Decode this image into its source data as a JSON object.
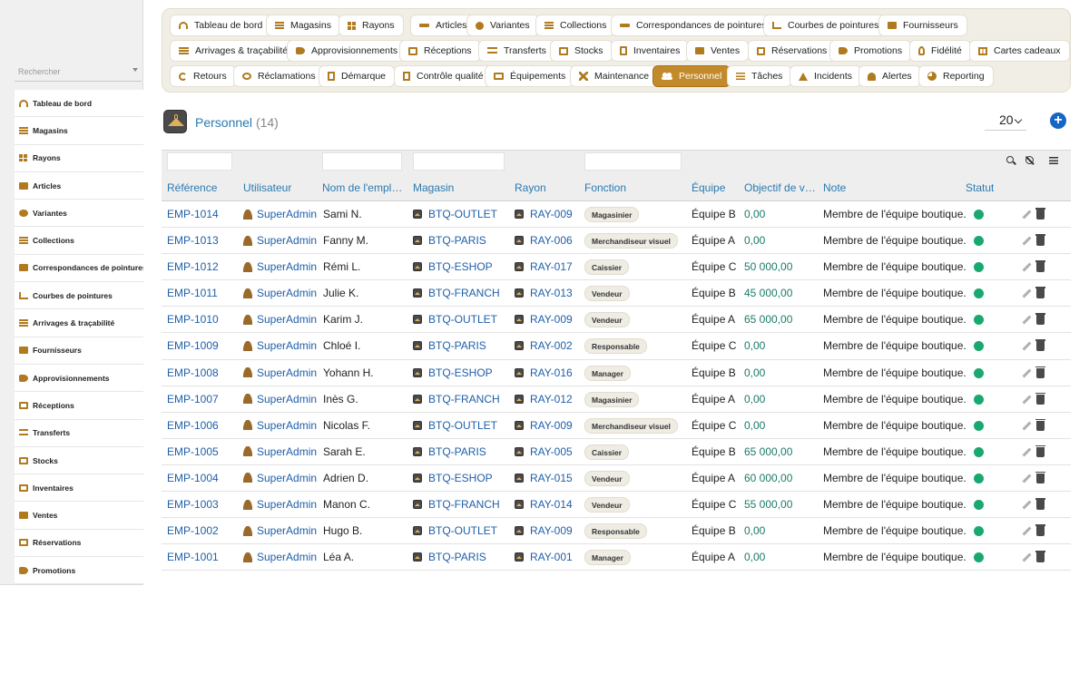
{
  "sidebar": {
    "search_placeholder": "Rechercher",
    "items": [
      {
        "label": "Tableau de bord",
        "icon": "gauge-icon"
      },
      {
        "label": "Magasins",
        "icon": "store-icon"
      },
      {
        "label": "Rayons",
        "icon": "grid-icon"
      },
      {
        "label": "Articles",
        "icon": "shirt-icon"
      },
      {
        "label": "Variantes",
        "icon": "palette-icon"
      },
      {
        "label": "Collections",
        "icon": "layers-icon"
      },
      {
        "label": "Correspondances de pointures",
        "icon": "ruler-icon"
      },
      {
        "label": "Courbes de pointures",
        "icon": "chart-icon"
      },
      {
        "label": "Arrivages & traçabilité",
        "icon": "barcode-icon"
      },
      {
        "label": "Fournisseurs",
        "icon": "folder-icon"
      },
      {
        "label": "Approvisionnements",
        "icon": "hand-icon"
      },
      {
        "label": "Réceptions",
        "icon": "truck-icon"
      },
      {
        "label": "Transferts",
        "icon": "exchange-icon"
      },
      {
        "label": "Stocks",
        "icon": "box-icon"
      },
      {
        "label": "Inventaires",
        "icon": "clipboard-icon"
      },
      {
        "label": "Ventes",
        "icon": "cart-icon"
      },
      {
        "label": "Réservations",
        "icon": "calendar-check-icon"
      },
      {
        "label": "Promotions",
        "icon": "tag-icon"
      }
    ]
  },
  "topnav": {
    "rows": [
      [
        {
          "label": "Tableau de bord",
          "icon": "gauge-icon"
        },
        {
          "label": "Magasins",
          "icon": "store-icon"
        },
        {
          "label": "Rayons",
          "icon": "grid-icon"
        },
        {
          "label": "Articles",
          "icon": "shirt-icon"
        },
        {
          "label": "Variantes",
          "icon": "palette-icon"
        },
        {
          "label": "Collections",
          "icon": "layers-icon"
        },
        {
          "label": "Correspondances de pointures",
          "icon": "ruler-icon"
        },
        {
          "label": "Courbes de pointures",
          "icon": "chart-icon"
        },
        {
          "label": "Fournisseurs",
          "icon": "folder-icon"
        }
      ],
      [
        {
          "label": "Arrivages & traçabilité",
          "icon": "barcode-icon"
        },
        {
          "label": "Approvisionnements",
          "icon": "hand-icon"
        },
        {
          "label": "Réceptions",
          "icon": "truck-icon"
        },
        {
          "label": "Transferts",
          "icon": "exchange-icon"
        },
        {
          "label": "Stocks",
          "icon": "box-icon"
        },
        {
          "label": "Inventaires",
          "icon": "clipboard-icon"
        },
        {
          "label": "Ventes",
          "icon": "cart-icon"
        },
        {
          "label": "Réservations",
          "icon": "calendar-check-icon"
        },
        {
          "label": "Promotions",
          "icon": "tag-icon"
        },
        {
          "label": "Fidélité",
          "icon": "award-icon"
        },
        {
          "label": "Cartes cadeaux",
          "icon": "gift-icon"
        }
      ],
      [
        {
          "label": "Retours",
          "icon": "undo-icon"
        },
        {
          "label": "Réclamations",
          "icon": "comment-icon"
        },
        {
          "label": "Démarque",
          "icon": "document-icon"
        },
        {
          "label": "Contrôle qualité",
          "icon": "check-document-icon"
        },
        {
          "label": "Équipements",
          "icon": "monitor-icon"
        },
        {
          "label": "Maintenance",
          "icon": "tools-icon"
        },
        {
          "label": "Personnel",
          "icon": "users-icon",
          "active": true
        },
        {
          "label": "Tâches",
          "icon": "list-icon"
        },
        {
          "label": "Incidents",
          "icon": "warning-icon"
        },
        {
          "label": "Alertes",
          "icon": "bell-icon"
        },
        {
          "label": "Reporting",
          "icon": "pie-chart-icon"
        }
      ]
    ]
  },
  "page": {
    "title": "Personnel",
    "count": "(14)",
    "per_page": "20"
  },
  "table": {
    "columns": [
      "Référence",
      "Utilisateur",
      "Nom de l'employé",
      "Magasin",
      "Rayon",
      "Fonction",
      "Équipe",
      "Objectif de ventes",
      "Note",
      "Statut"
    ],
    "rows": [
      {
        "ref": "EMP-1014",
        "user": "SuperAdmin",
        "name": "Sami N.",
        "store": "BTQ-OUTLET",
        "dept": "RAY-009",
        "role": "Magasinier",
        "team": "Équipe B",
        "target": "0,00",
        "note": "Membre de l'équipe boutique."
      },
      {
        "ref": "EMP-1013",
        "user": "SuperAdmin",
        "name": "Fanny M.",
        "store": "BTQ-PARIS",
        "dept": "RAY-006",
        "role": "Merchandiseur visuel",
        "team": "Équipe A",
        "target": "0,00",
        "note": "Membre de l'équipe boutique."
      },
      {
        "ref": "EMP-1012",
        "user": "SuperAdmin",
        "name": "Rémi L.",
        "store": "BTQ-ESHOP",
        "dept": "RAY-017",
        "role": "Caissier",
        "team": "Équipe C",
        "target": "50 000,00",
        "note": "Membre de l'équipe boutique."
      },
      {
        "ref": "EMP-1011",
        "user": "SuperAdmin",
        "name": "Julie K.",
        "store": "BTQ-FRANCH",
        "dept": "RAY-013",
        "role": "Vendeur",
        "team": "Équipe B",
        "target": "45 000,00",
        "note": "Membre de l'équipe boutique."
      },
      {
        "ref": "EMP-1010",
        "user": "SuperAdmin",
        "name": "Karim J.",
        "store": "BTQ-OUTLET",
        "dept": "RAY-009",
        "role": "Vendeur",
        "team": "Équipe A",
        "target": "65 000,00",
        "note": "Membre de l'équipe boutique."
      },
      {
        "ref": "EMP-1009",
        "user": "SuperAdmin",
        "name": "Chloé I.",
        "store": "BTQ-PARIS",
        "dept": "RAY-002",
        "role": "Responsable",
        "team": "Équipe C",
        "target": "0,00",
        "note": "Membre de l'équipe boutique."
      },
      {
        "ref": "EMP-1008",
        "user": "SuperAdmin",
        "name": "Yohann H.",
        "store": "BTQ-ESHOP",
        "dept": "RAY-016",
        "role": "Manager",
        "team": "Équipe B",
        "target": "0,00",
        "note": "Membre de l'équipe boutique."
      },
      {
        "ref": "EMP-1007",
        "user": "SuperAdmin",
        "name": "Inès G.",
        "store": "BTQ-FRANCH",
        "dept": "RAY-012",
        "role": "Magasinier",
        "team": "Équipe A",
        "target": "0,00",
        "note": "Membre de l'équipe boutique."
      },
      {
        "ref": "EMP-1006",
        "user": "SuperAdmin",
        "name": "Nicolas F.",
        "store": "BTQ-OUTLET",
        "dept": "RAY-009",
        "role": "Merchandiseur visuel",
        "team": "Équipe C",
        "target": "0,00",
        "note": "Membre de l'équipe boutique."
      },
      {
        "ref": "EMP-1005",
        "user": "SuperAdmin",
        "name": "Sarah E.",
        "store": "BTQ-PARIS",
        "dept": "RAY-005",
        "role": "Caissier",
        "team": "Équipe B",
        "target": "65 000,00",
        "note": "Membre de l'équipe boutique."
      },
      {
        "ref": "EMP-1004",
        "user": "SuperAdmin",
        "name": "Adrien D.",
        "store": "BTQ-ESHOP",
        "dept": "RAY-015",
        "role": "Vendeur",
        "team": "Équipe A",
        "target": "60 000,00",
        "note": "Membre de l'équipe boutique."
      },
      {
        "ref": "EMP-1003",
        "user": "SuperAdmin",
        "name": "Manon C.",
        "store": "BTQ-FRANCH",
        "dept": "RAY-014",
        "role": "Vendeur",
        "team": "Équipe C",
        "target": "55 000,00",
        "note": "Membre de l'équipe boutique."
      },
      {
        "ref": "EMP-1002",
        "user": "SuperAdmin",
        "name": "Hugo B.",
        "store": "BTQ-OUTLET",
        "dept": "RAY-009",
        "role": "Responsable",
        "team": "Équipe B",
        "target": "0,00",
        "note": "Membre de l'équipe boutique."
      },
      {
        "ref": "EMP-1001",
        "user": "SuperAdmin",
        "name": "Léa A.",
        "store": "BTQ-PARIS",
        "dept": "RAY-001",
        "role": "Manager",
        "team": "Équipe A",
        "target": "0,00",
        "note": "Membre de l'équipe boutique."
      }
    ]
  },
  "colors": {
    "accent": "#c28a2a",
    "link": "#1f5fa8",
    "header_text": "#2a7ab0",
    "status_active": "#18a870",
    "target_value": "#1a7a6a",
    "add_button": "#1666c5"
  }
}
